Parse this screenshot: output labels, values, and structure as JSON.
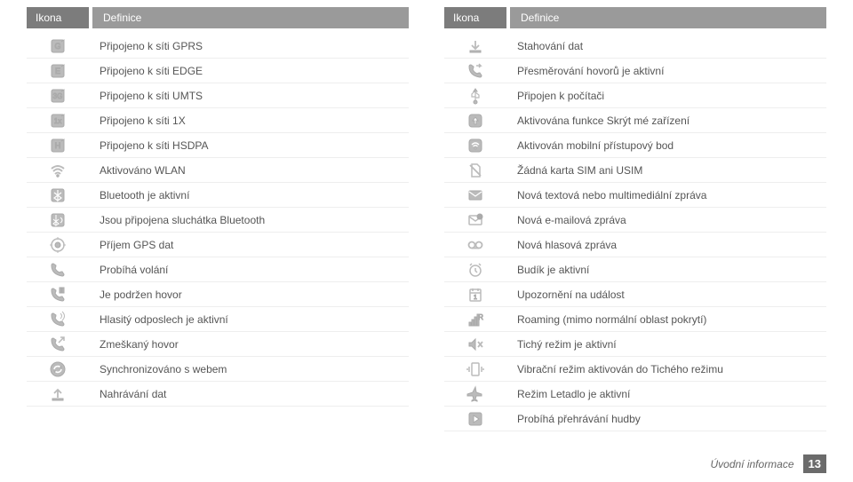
{
  "headers": {
    "icon": "Ikona",
    "definition": "Definice"
  },
  "left": [
    {
      "icon": "gprs",
      "text": "Připojeno k síti GPRS"
    },
    {
      "icon": "edge",
      "text": "Připojeno k síti EDGE"
    },
    {
      "icon": "umts",
      "text": "Připojeno k síti UMTS"
    },
    {
      "icon": "onex",
      "text": "Připojeno k síti 1X"
    },
    {
      "icon": "hsdpa",
      "text": "Připojeno k síti HSDPA"
    },
    {
      "icon": "wlan",
      "text": "Aktivováno WLAN"
    },
    {
      "icon": "bt",
      "text": "Bluetooth je aktivní"
    },
    {
      "icon": "bthead",
      "text": "Jsou připojena sluchátka Bluetooth"
    },
    {
      "icon": "gps",
      "text": "Příjem GPS dat"
    },
    {
      "icon": "call",
      "text": "Probíhá volání"
    },
    {
      "icon": "hold",
      "text": "Je podržen hovor"
    },
    {
      "icon": "speaker",
      "text": "Hlasitý odposlech je aktivní"
    },
    {
      "icon": "missed",
      "text": "Zmeškaný hovor"
    },
    {
      "icon": "sync",
      "text": "Synchronizováno s webem"
    },
    {
      "icon": "upload",
      "text": "Nahrávání dat"
    }
  ],
  "right": [
    {
      "icon": "download",
      "text": "Stahování dat"
    },
    {
      "icon": "forward",
      "text": "Přesměrování hovorů je aktivní"
    },
    {
      "icon": "usb",
      "text": "Připojen k počítači"
    },
    {
      "icon": "hide",
      "text": "Aktivována funkce Skrýt mé zařízení"
    },
    {
      "icon": "ap",
      "text": "Aktivován mobilní přístupový bod"
    },
    {
      "icon": "nosim",
      "text": "Žádná karta SIM ani USIM"
    },
    {
      "icon": "sms",
      "text": "Nová textová nebo multimediální zpráva"
    },
    {
      "icon": "email",
      "text": "Nová e-mailová zpráva"
    },
    {
      "icon": "voicemail",
      "text": "Nová hlasová zpráva"
    },
    {
      "icon": "alarm",
      "text": "Budík je aktivní"
    },
    {
      "icon": "event",
      "text": "Upozornění na událost"
    },
    {
      "icon": "roaming",
      "text": "Roaming (mimo normální oblast pokrytí)"
    },
    {
      "icon": "silent",
      "text": "Tichý režim je aktivní"
    },
    {
      "icon": "vibrate",
      "text": "Vibrační režim aktivován do Tichého režimu"
    },
    {
      "icon": "airplane",
      "text": "Režim Letadlo je aktivní"
    },
    {
      "icon": "play",
      "text": "Probíhá přehrávání hudby"
    }
  ],
  "footer": {
    "section": "Úvodní informace",
    "page": "13"
  }
}
